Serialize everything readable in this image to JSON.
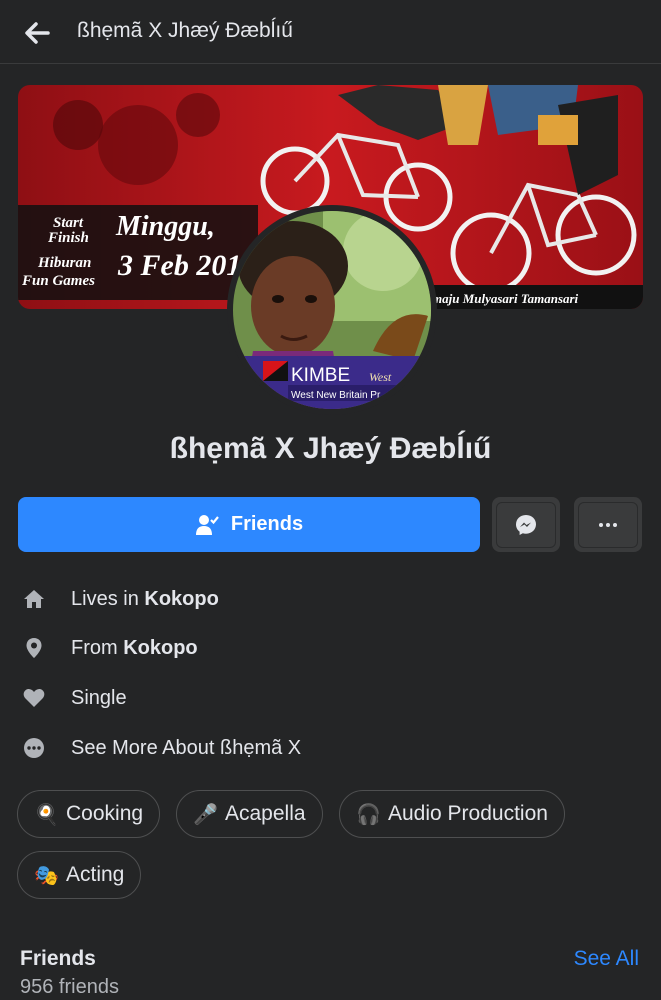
{
  "header": {
    "title": "ßhẹmã X Jhæý Ðæbĺıű"
  },
  "cover": {
    "lines": [
      "Start",
      "Finish",
      "Minggu,",
      "Hiburan",
      "Fun Games",
      "3 Feb 201",
      "maju Mulyasari Tamansari"
    ]
  },
  "avatar": {
    "badge": "KIMBE",
    "badge_sub": "West New Britain Pr",
    "badge_script": "West"
  },
  "profile": {
    "name": "ßhẹmã X Jhæý Ðæbĺıű"
  },
  "actions": {
    "friends_label": "Friends",
    "messenger_icon": "messenger-icon",
    "more_icon": "more-icon"
  },
  "intro": [
    {
      "prefix": "Lives in ",
      "value": "Kokopo",
      "icon": "home-icon"
    },
    {
      "prefix": "From ",
      "value": "Kokopo",
      "icon": "location-pin-icon"
    },
    {
      "prefix": "Single",
      "value": "",
      "icon": "heart-icon"
    },
    {
      "prefix": "See More About ßhẹmã X",
      "value": "",
      "icon": "ellipsis-icon"
    }
  ],
  "hobbies": [
    {
      "emoji": "🍳",
      "label": "Cooking"
    },
    {
      "emoji": "🎤",
      "label": "Acapella"
    },
    {
      "emoji": "🎧",
      "label": "Audio Production"
    },
    {
      "emoji": "🎭",
      "label": "Acting"
    }
  ],
  "friends": {
    "title": "Friends",
    "see_all": "See All",
    "count": "956 friends"
  },
  "colors": {
    "background": "#242526",
    "accent": "#2d88ff",
    "secondary_button": "#3a3b3c"
  }
}
